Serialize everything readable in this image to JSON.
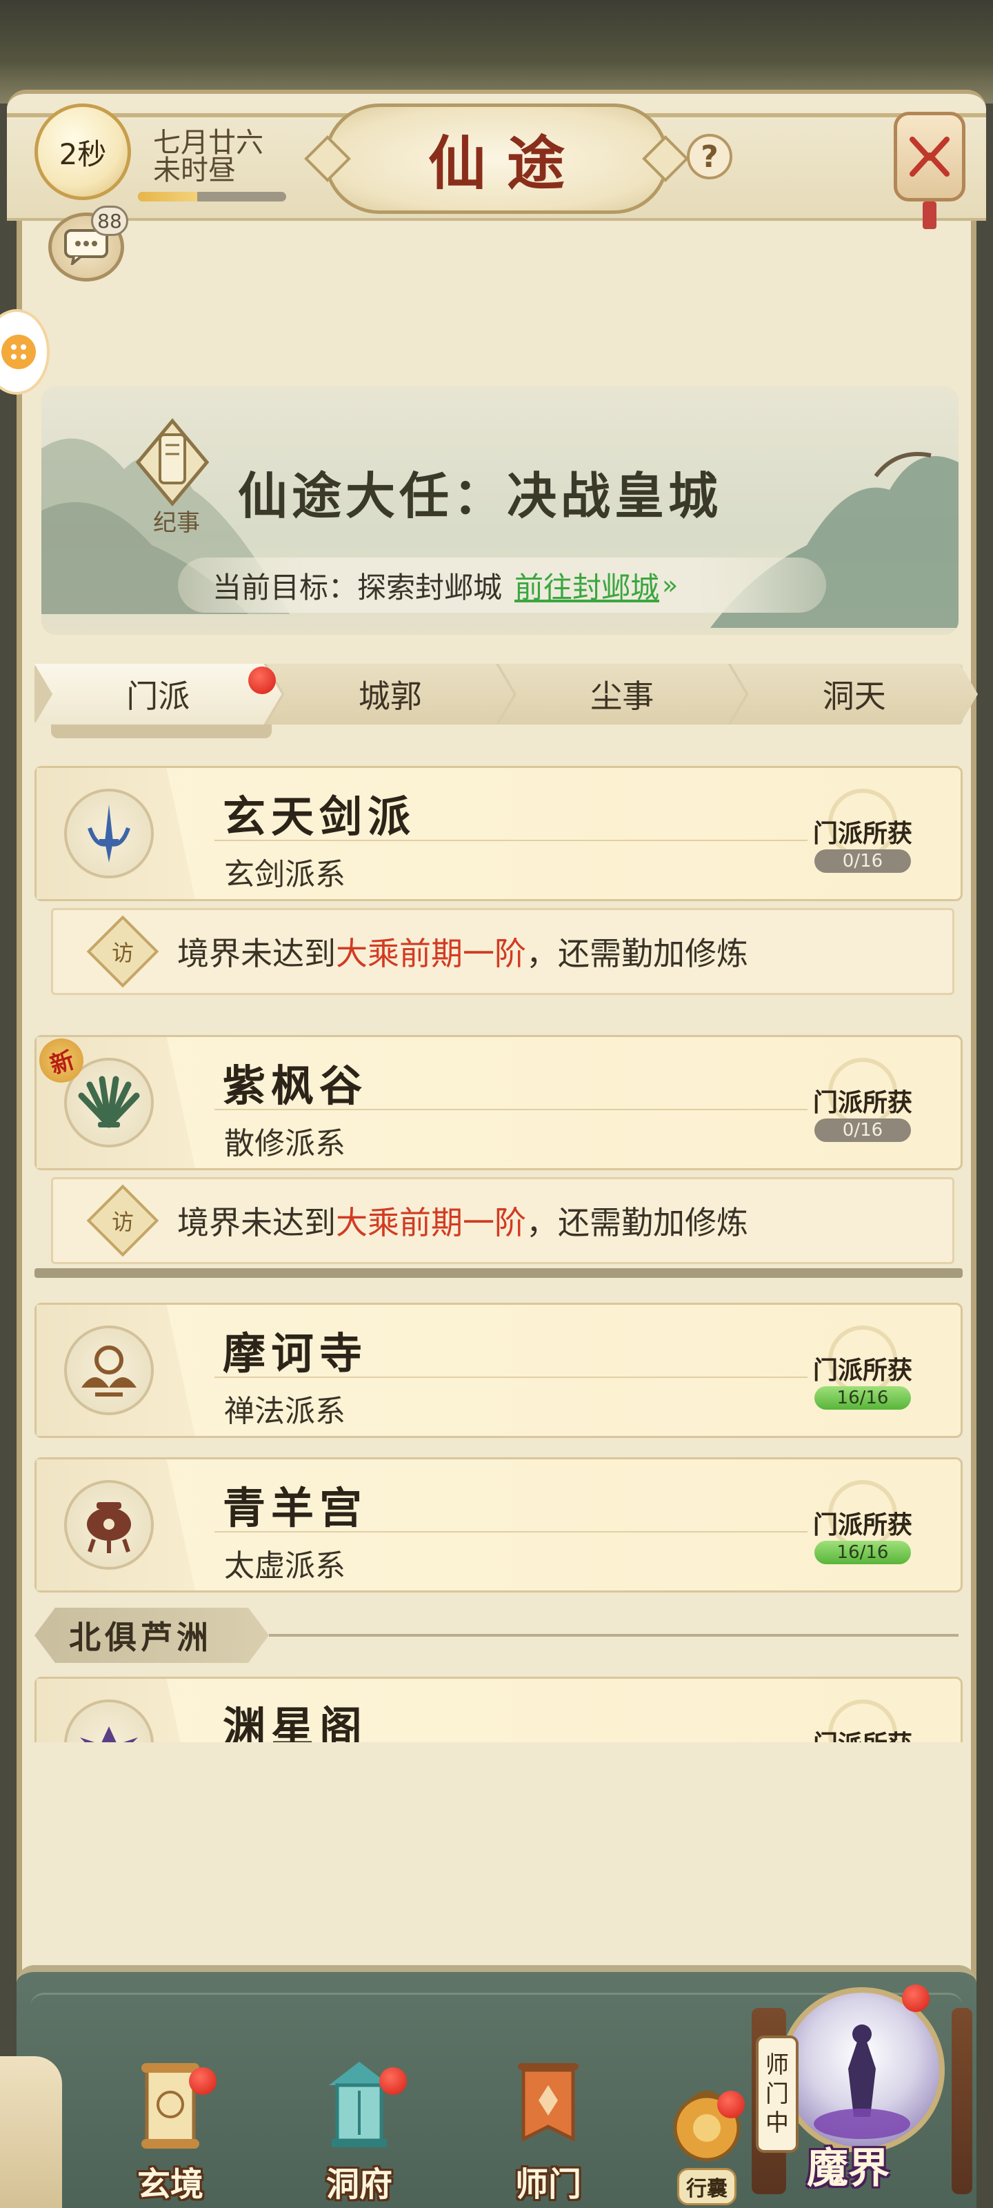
{
  "header": {
    "timer": "2秒",
    "date_line1": "七月廿六",
    "date_line2": "未时昼",
    "day_progress_percent": 40,
    "title": "仙途",
    "help_label": "?",
    "chat_unread_count": "88",
    "icons": {
      "menu": "lantern-menu-icon",
      "chat": "chat-bubble-icon",
      "side": "gamepad-icon"
    }
  },
  "banner": {
    "chronicle_label": "纪事",
    "quest_title": "仙途大任：决战皇城",
    "objective_prefix": "当前目标：探索封邺城",
    "objective_link": "前往封邺城",
    "objective_arrow": "»"
  },
  "tabs": [
    {
      "label": "门派",
      "active": true,
      "has_dot": true
    },
    {
      "label": "城郭",
      "active": false,
      "has_dot": false
    },
    {
      "label": "尘事",
      "active": false,
      "has_dot": false
    },
    {
      "label": "洞天",
      "active": false,
      "has_dot": false
    }
  ],
  "sects": [
    {
      "name": "玄天剑派",
      "school": "玄剑派系",
      "gain_label": "门派所获",
      "gain_count": "0/16",
      "emblem": "sword-emblem-icon",
      "requirement": {
        "icon_label": "访",
        "prefix": "境界未达到",
        "highlight": "大乘前期一阶",
        "suffix": "，还需勤加修炼"
      }
    },
    {
      "name": "紫枫谷",
      "school": "散修派系",
      "gain_label": "门派所获",
      "gain_count": "0/16",
      "new_tag": "新",
      "emblem": "leaf-fan-emblem-icon",
      "requirement": {
        "icon_label": "访",
        "prefix": "境界未达到",
        "highlight": "大乘前期一阶",
        "suffix": "，还需勤加修炼"
      }
    },
    {
      "name": "摩诃寺",
      "school": "禅法派系",
      "gain_label": "门派所获",
      "gain_count": "16/16",
      "emblem": "lotus-emblem-icon"
    },
    {
      "name": "青羊宫",
      "school": "太虚派系",
      "gain_label": "门派所获",
      "gain_count": "16/16",
      "emblem": "censer-emblem-icon"
    }
  ],
  "region": {
    "label": "北俱芦洲"
  },
  "partial_sect": {
    "name": "渊星阁",
    "gain_label": "门派所获",
    "emblem": "star-emblem-icon"
  },
  "bottom_nav": [
    {
      "label": "玄境",
      "icon": "scroll-icon",
      "has_dot": true
    },
    {
      "label": "洞府",
      "icon": "pavilion-icon",
      "has_dot": true
    },
    {
      "label": "师门",
      "icon": "banner-flag-icon",
      "has_dot": false
    },
    {
      "label": "行囊",
      "icon": "bag-icon",
      "has_dot": true
    }
  ],
  "demon_realm": {
    "label": "魔界",
    "master_sign": [
      "师",
      "门",
      "中"
    ],
    "has_dot": true
  },
  "colors": {
    "accent_red": "#d23b22",
    "link_green": "#3aa640",
    "title_red": "#8a2e1c",
    "parchment": "#f0e8cf"
  }
}
